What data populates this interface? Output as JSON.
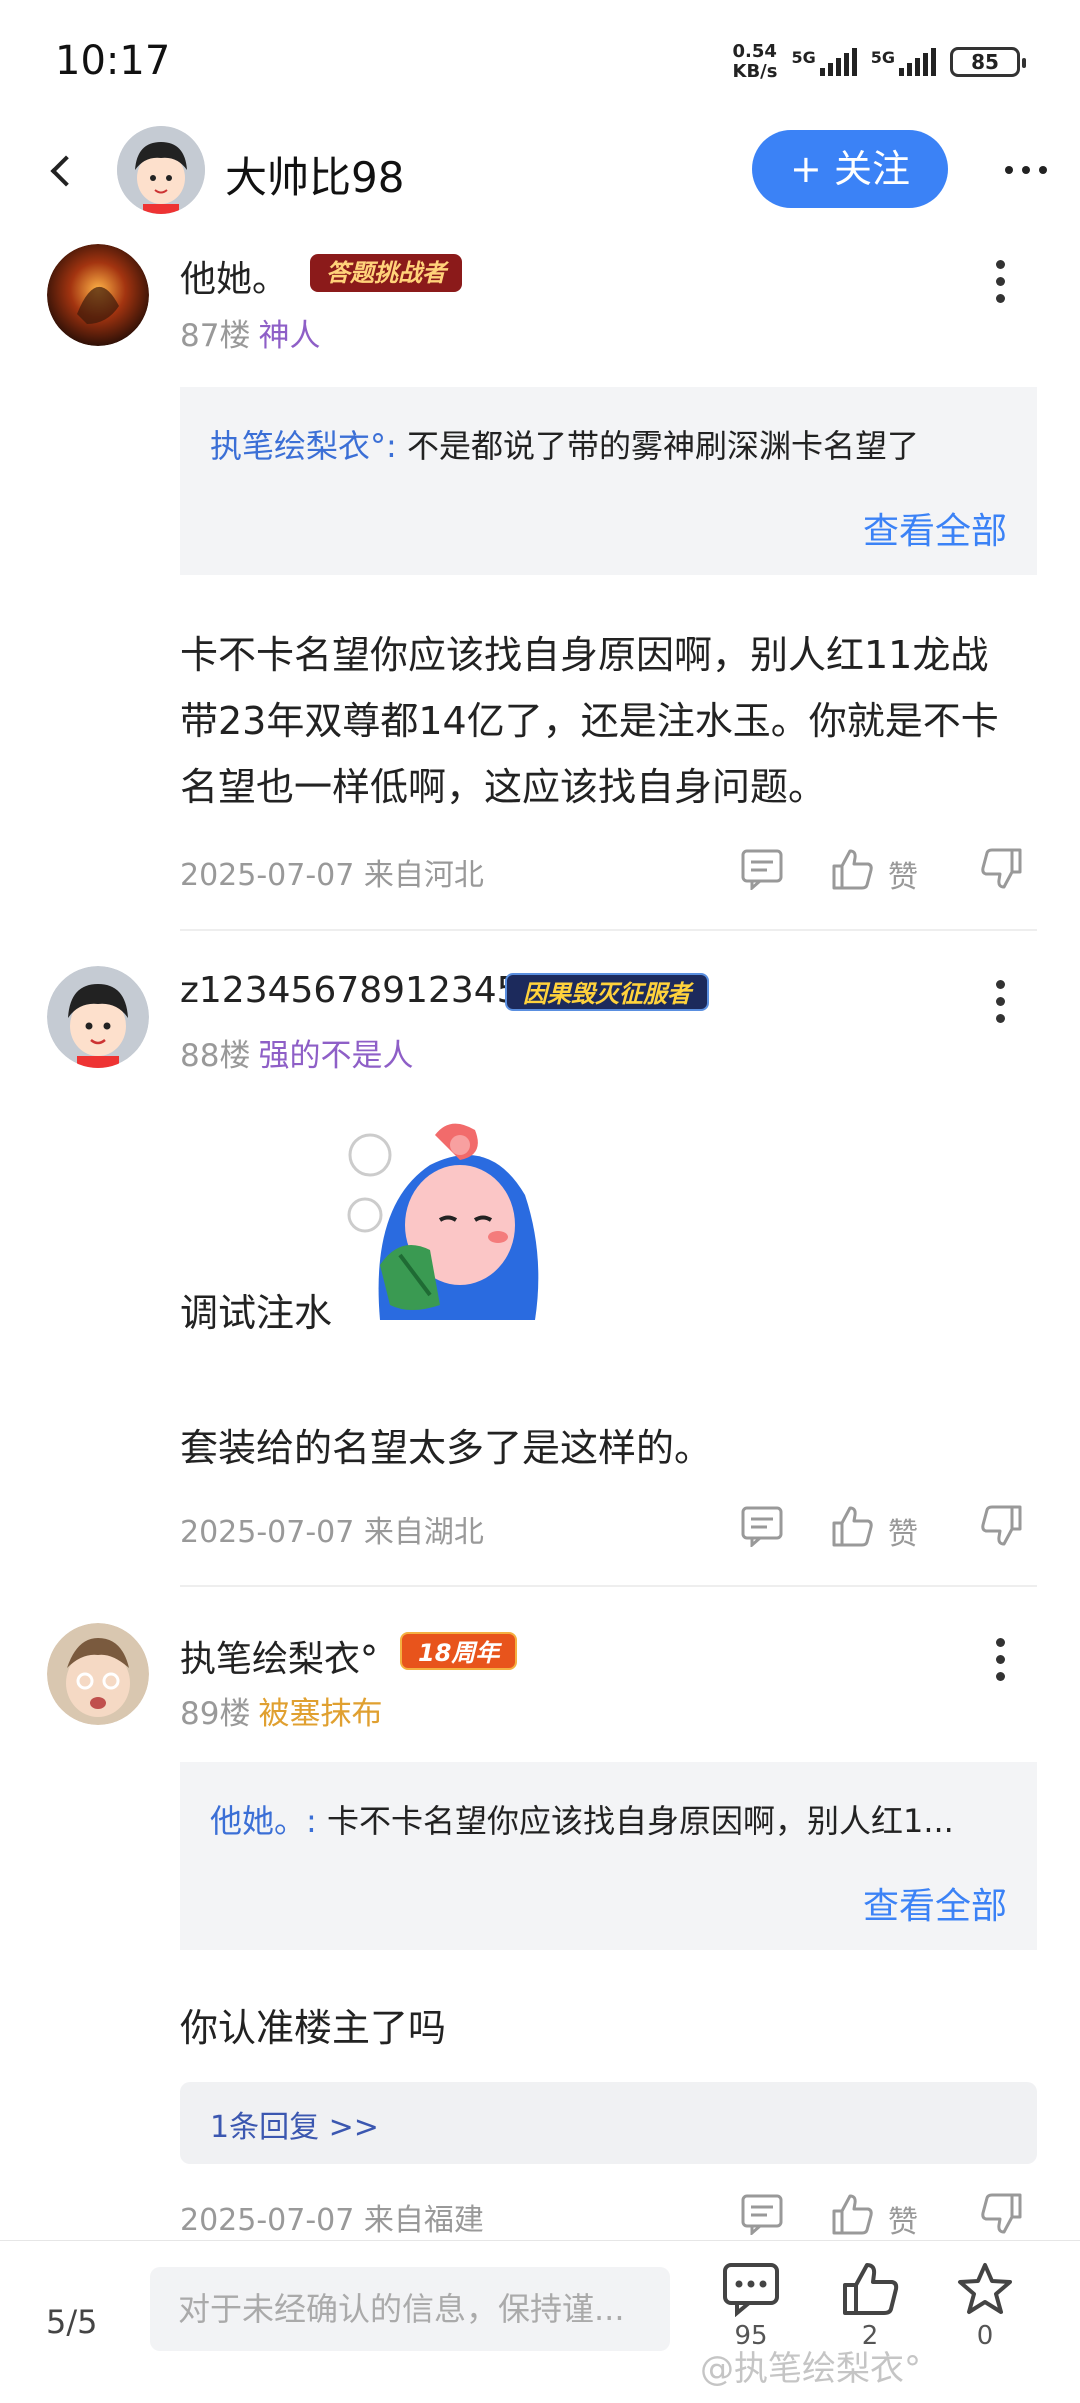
{
  "status_bar": {
    "time": "10:17",
    "net_speed": "0.54",
    "net_unit": "KB/s",
    "sim1": "5G",
    "sim2": "5G",
    "battery": "85"
  },
  "header": {
    "title": "大帅比98",
    "follow_label": "+ 关注"
  },
  "comments": [
    {
      "username": "他她。",
      "badge": "答题挑战者",
      "badge_color": "#8b1a1a",
      "floor": "87楼",
      "title": "神人",
      "title_color": "#8e5fc7",
      "quote": {
        "name": "执笔绘梨衣°:",
        "text": "不是都说了带的雾神刷深渊卡名望了",
        "view_all": "查看全部"
      },
      "body_lines": [
        "卡不卡名望你应该找自身原因啊，别人红11龙战",
        "带23年双尊都14亿了，还是注水玉。你就是不卡",
        "名望也一样低啊，这应该找自身问题。"
      ],
      "meta": "2025-07-07 来自河北",
      "like_label": "赞"
    },
    {
      "username": "z12345678912345",
      "badge": "因果毁灭征服者",
      "badge_color": "#1c2a5c",
      "floor": "88楼",
      "title": "强的不是人",
      "title_color": "#8e5fc7",
      "body_lines": [
        "调试注水"
      ],
      "body2": "套装给的名望太多了是这样的。",
      "meta": "2025-07-07 来自湖北",
      "like_label": "赞"
    },
    {
      "username": "执笔绘梨衣°",
      "badge": "18周年",
      "badge_color": "#e8541c",
      "floor": "89楼",
      "title": "被塞抹布",
      "title_color": "#e0a030",
      "quote": {
        "name": "他她。:",
        "text": "卡不卡名望你应该找自身原因啊，别人红1...",
        "view_all": "查看全部"
      },
      "body_lines": [
        "你认准楼主了吗"
      ],
      "reply": "1条回复 >>",
      "meta": "2025-07-07 来自福建",
      "like_label": "赞"
    }
  ],
  "bottom_bar": {
    "pager": "5/5",
    "input_placeholder": "对于未经确认的信息，保持谨...",
    "comment_count": "95",
    "like_count": "2",
    "star_count": "0",
    "watermark": "@执笔绘梨衣°"
  },
  "colors": {
    "accent": "#3b82f6",
    "link": "#3b6fd6",
    "meta": "#999999"
  }
}
